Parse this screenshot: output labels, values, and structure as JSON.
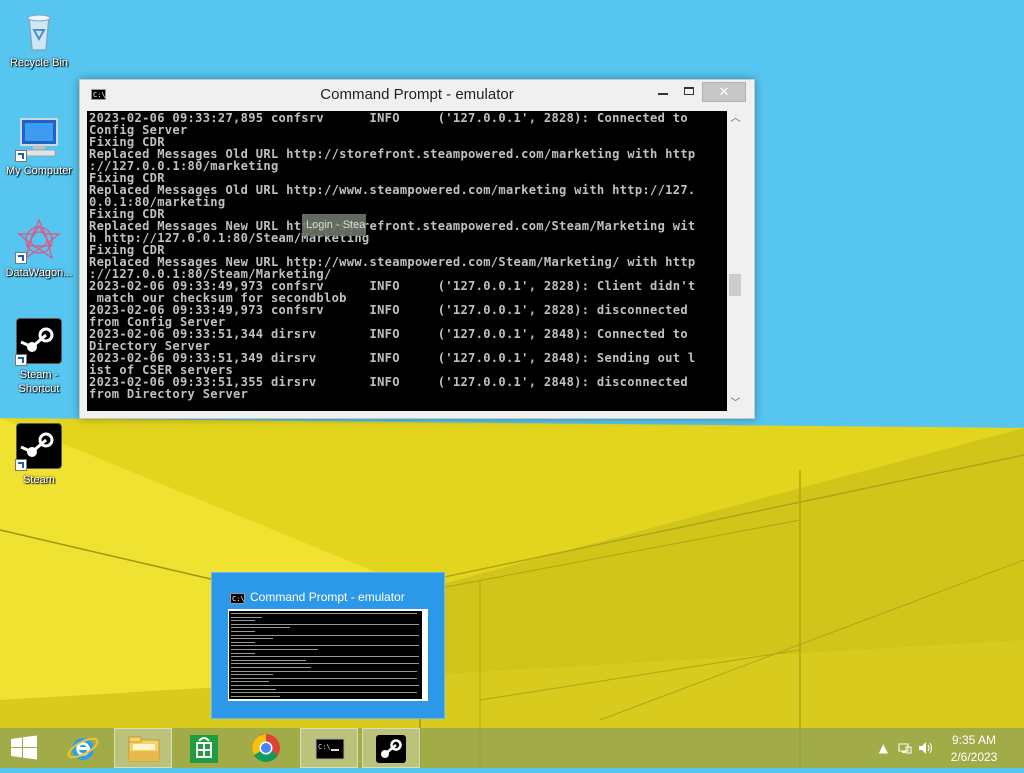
{
  "colors": {
    "sky": "#56c5ef",
    "wall_yellow": "#e3d51d",
    "console_bg": "#000000",
    "console_fg": "#c0c0c0",
    "preview_bg": "#2b99e8"
  },
  "desktop": {
    "icons": [
      {
        "label": "Recycle Bin",
        "icon": "recycle-bin-icon"
      },
      {
        "label": "My Computer",
        "icon": "computer-icon"
      },
      {
        "label": "DataWagon...",
        "icon": "datawagon-icon"
      },
      {
        "label": "Steam - Shortcut",
        "icon": "steam-icon"
      },
      {
        "label": "Steam",
        "icon": "steam-icon"
      }
    ]
  },
  "window": {
    "title": "Command Prompt - emulator",
    "icon": "cmd-icon",
    "close_label": "✕",
    "console_lines": [
      "2023-02-06 09:33:27,895 confsrv      INFO     ('127.0.0.1', 2828): Connected to",
      "Config Server",
      "Fixing CDR",
      "Replaced Messages Old URL http://storefront.steampowered.com/marketing with http",
      "://127.0.0.1:80/marketing",
      "Fixing CDR",
      "Replaced Messages Old URL http://www.steampowered.com/marketing with http://127.",
      "0.0.1:80/marketing",
      "Fixing CDR",
      "Replaced Messages New URL http://storefront.steampowered.com/Steam/Marketing wit",
      "h http://127.0.0.1:80/Steam/Marketing",
      "Fixing CDR",
      "Replaced Messages New URL http://www.steampowered.com/Steam/Marketing/ with http",
      "://127.0.0.1:80/Steam/Marketing/",
      "2023-02-06 09:33:49,973 confsrv      INFO     ('127.0.0.1', 2828): Client didn't",
      " match our checksum for secondblob",
      "2023-02-06 09:33:49,973 confsrv      INFO     ('127.0.0.1', 2828): disconnected",
      "from Config Server",
      "2023-02-06 09:33:51,344 dirsrv       INFO     ('127.0.0.1', 2848): Connected to",
      "Directory Server",
      "2023-02-06 09:33:51,349 dirsrv       INFO     ('127.0.0.1', 2848): Sending out l",
      "ist of CSER servers",
      "2023-02-06 09:33:51,355 dirsrv       INFO     ('127.0.0.1', 2848): disconnected",
      "from Directory Server"
    ],
    "tooltip": "Login - Steam"
  },
  "preview": {
    "title": "Command Prompt - emulator"
  },
  "taskbar": {
    "buttons": [
      {
        "name": "start-button",
        "icon": "windows-logo-icon"
      },
      {
        "name": "internet-explorer",
        "icon": "internet-explorer-icon"
      },
      {
        "name": "file-explorer",
        "icon": "folder-icon"
      },
      {
        "name": "store",
        "icon": "store-icon"
      },
      {
        "name": "chrome",
        "icon": "chrome-icon"
      },
      {
        "name": "command-prompt",
        "icon": "cmd-icon"
      },
      {
        "name": "steam",
        "icon": "steam-icon"
      }
    ],
    "clock": {
      "time": "9:35 AM",
      "date": "2/6/2023"
    }
  }
}
